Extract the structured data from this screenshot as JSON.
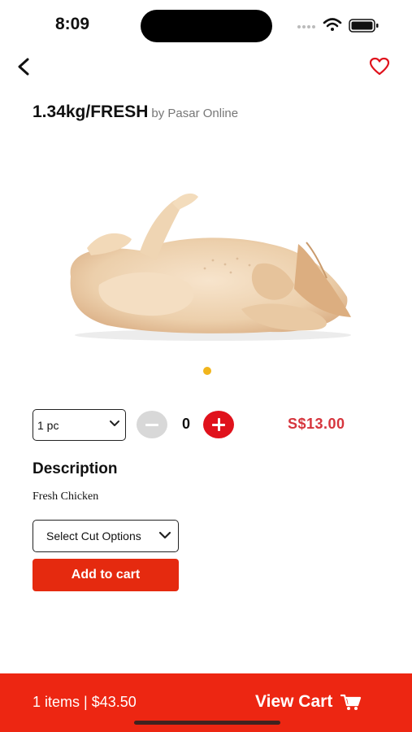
{
  "status": {
    "time": "8:09"
  },
  "product": {
    "title": "1.34kg/FRESH",
    "vendor": "by Pasar Online",
    "image_alt": "raw whole chicken",
    "unit": "1 pc",
    "quantity": "0",
    "price": "S$13.00",
    "description_heading": "Description",
    "description": "Fresh Chicken",
    "cut_options_label": "Select Cut Options",
    "add_to_cart_label": "Add to cart",
    "carousel": {
      "slides": 1,
      "active": 1
    }
  },
  "cart": {
    "summary": "1 items | $43.50",
    "view_cart_label": "View Cart"
  },
  "colors": {
    "accent": "#ed2612",
    "plus_button": "#e0121c",
    "price": "#d6353d",
    "carousel_dot": "#f1b51c",
    "heart": "#e0121c"
  },
  "icons": [
    "back-arrow-icon",
    "heart-icon",
    "chevron-down-icon",
    "minus-icon",
    "plus-icon",
    "cart-icon",
    "wifi-icon",
    "battery-icon",
    "signal-icon"
  ]
}
